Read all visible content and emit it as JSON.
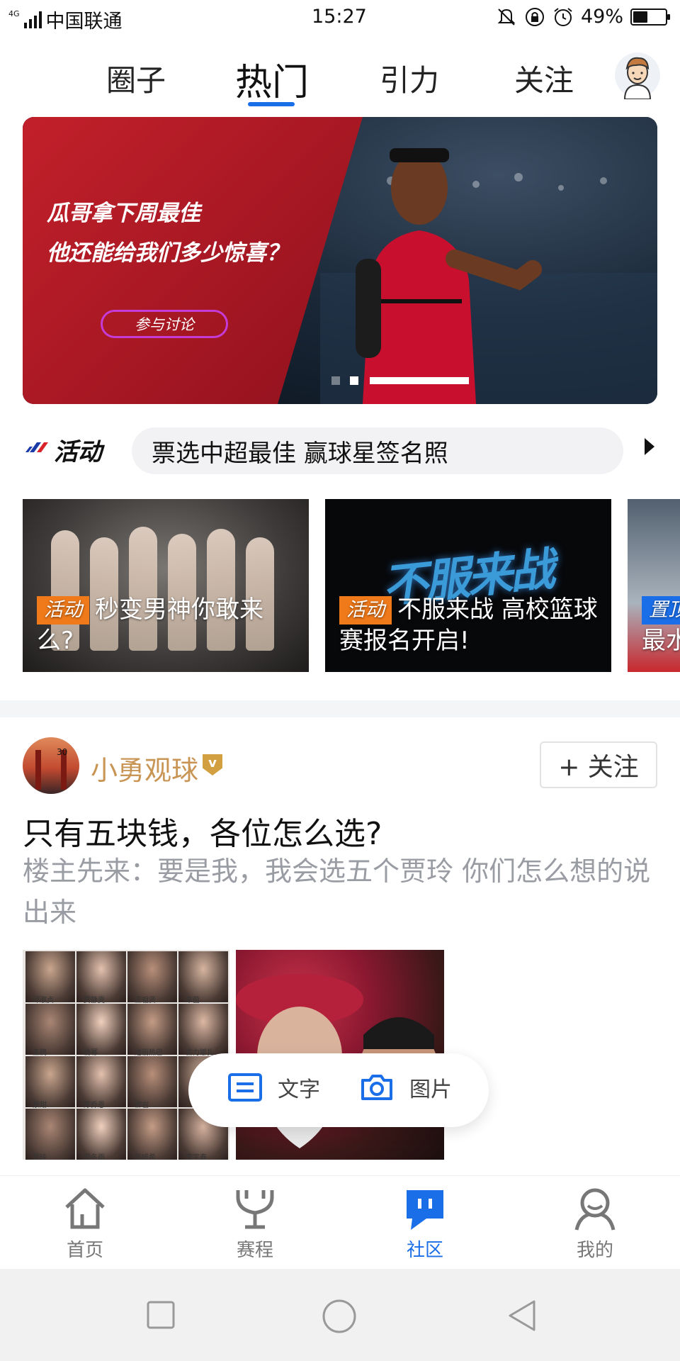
{
  "status_bar": {
    "network": "4G",
    "carrier": "中国联通",
    "time": "15:27",
    "battery_text": "49%",
    "battery_level": 0.49
  },
  "top_tabs": [
    {
      "label": "圈子",
      "active": false
    },
    {
      "label": "热门",
      "active": true
    },
    {
      "label": "引力",
      "active": false
    },
    {
      "label": "关注",
      "active": false
    }
  ],
  "banner": {
    "line1": "瓜哥拿下周最佳",
    "line2": "他还能给我们多少惊喜？",
    "button": "参与讨论",
    "slide_count": 2,
    "active_slide": 2
  },
  "activity": {
    "label": "活动",
    "headline": "票选中超最佳 赢球星签名照"
  },
  "cards": [
    {
      "badge": "活动",
      "text": "秒变男神你敢来么?",
      "badge_color": "#f07a1a"
    },
    {
      "badge": "活动",
      "text": "不服来战 高校篮球赛报名开启!",
      "badge_color": "#f07a1a",
      "art_text": "不服来战"
    },
    {
      "badge": "置顶",
      "text": "最水",
      "badge_color": "#1a6ee8"
    }
  ],
  "post": {
    "author": "小勇观球",
    "avatar_number": "30",
    "verified_mark": "v",
    "follow_label": "+ 关注",
    "title": "只有五块钱，各位怎么选?",
    "body": "楼主先来：要是我，我会选五个贾玲 你们怎么想的说出来",
    "grid_names": [
      "邱淑贞",
      "贾静雯",
      "王祖贤",
      "朱茵",
      "王鸥",
      "杨幂",
      "迪丽热巴",
      "古力娜扎",
      "景甜",
      "陈乔恩",
      "柳岩",
      "",
      "贾玲",
      "周冬雨",
      "陈妍希",
      "李宇春"
    ]
  },
  "compose": {
    "text_label": "文字",
    "image_label": "图片"
  },
  "bottom_nav": [
    {
      "label": "首页",
      "icon": "home-icon",
      "active": false
    },
    {
      "label": "赛程",
      "icon": "trophy-icon",
      "active": false
    },
    {
      "label": "社区",
      "icon": "community-icon",
      "active": true
    },
    {
      "label": "我的",
      "icon": "profile-icon",
      "active": false
    }
  ],
  "colors": {
    "accent": "#1a6ee8",
    "badge_orange": "#f07a1a",
    "author_gold": "#c99555",
    "muted_text": "#9a9ca3"
  }
}
